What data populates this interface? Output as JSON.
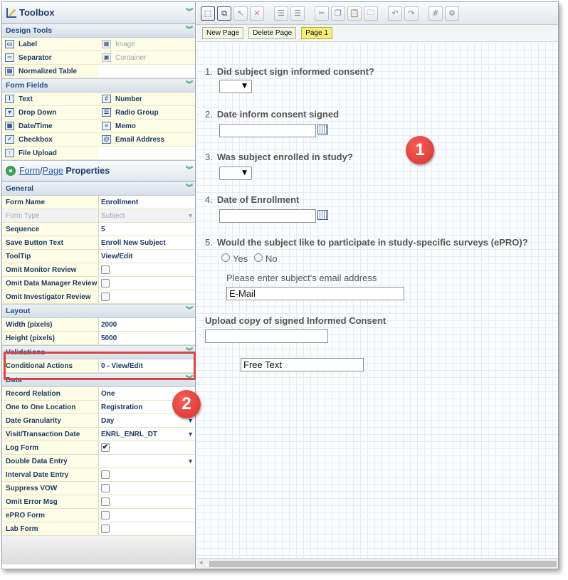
{
  "toolbox": {
    "title": "Toolbox",
    "design_tools": {
      "heading": "Design Tools",
      "items": [
        {
          "label": "Label",
          "icon": "label-icon",
          "enabled": true
        },
        {
          "label": "Image",
          "icon": "image-icon",
          "enabled": false
        },
        {
          "label": "Separator",
          "icon": "separator-icon",
          "enabled": true
        },
        {
          "label": "Container",
          "icon": "container-icon",
          "enabled": false
        },
        {
          "label": "Normalized Table",
          "icon": "table-icon",
          "enabled": true
        }
      ]
    },
    "form_fields": {
      "heading": "Form Fields",
      "items": [
        {
          "label": "Text",
          "icon": "text-field-icon"
        },
        {
          "label": "Number",
          "icon": "number-field-icon"
        },
        {
          "label": "Drop Down",
          "icon": "dropdown-icon"
        },
        {
          "label": "Radio Group",
          "icon": "radio-group-icon"
        },
        {
          "label": "Date/Time",
          "icon": "calendar-icon"
        },
        {
          "label": "Memo",
          "icon": "memo-icon"
        },
        {
          "label": "Checkbox",
          "icon": "checkbox-icon"
        },
        {
          "label": "Email Address",
          "icon": "email-icon"
        },
        {
          "label": "File Upload",
          "icon": "file-upload-icon"
        }
      ]
    }
  },
  "properties": {
    "title_prefix_1": "Form",
    "title_sep": "/",
    "title_prefix_2": "Page",
    "title_suffix": " Properties",
    "general": {
      "heading": "General",
      "form_name_label": "Form Name",
      "form_name": "Enrollment",
      "form_type_label": "Form Type",
      "form_type": "Subject",
      "sequence_label": "Sequence",
      "sequence": "5",
      "save_button_text_label": "Save Button Text",
      "save_button_text": "Enroll New Subject",
      "tooltip_label": "ToolTip",
      "tooltip": "View/Edit",
      "omit_monitor_label": "Omit Monitor Review",
      "omit_dm_label": "Omit Data Manager Review",
      "omit_investigator_label": "Omit Investigator Review"
    },
    "layout": {
      "heading": "Layout",
      "width_label": "Width (pixels)",
      "width": "2000",
      "height_label": "Height (pixels)",
      "height": "5000"
    },
    "validations": {
      "heading": "Validations",
      "conditional_actions_label": "Conditional Actions",
      "conditional_actions": "0 - View/Edit"
    },
    "data": {
      "heading": "Data",
      "record_relation_label": "Record Relation",
      "record_relation": "One",
      "one_to_one_label": "One to One Location",
      "one_to_one": "Registration",
      "date_granularity_label": "Date Granularity",
      "date_granularity": "Day",
      "visit_date_label": "Visit/Transaction Date",
      "visit_date": "ENRL_ENRL_DT",
      "log_form_label": "Log Form",
      "log_form_checked": true,
      "double_data_label": "Double Data Entry",
      "interval_date_label": "Interval Date Entry",
      "suppress_vow_label": "Suppress VOW",
      "omit_error_label": "Omit Error Msg",
      "epro_label": "ePRO Form",
      "lab_form_label": "Lab Form"
    }
  },
  "page_buttons": {
    "new_page": "New Page",
    "delete_page": "Delete Page",
    "page_1": "Page 1"
  },
  "form": {
    "q1_num": "1.",
    "q1": "Did subject sign informed consent?",
    "q2_num": "2.",
    "q2": "Date inform consent signed",
    "q3_num": "3.",
    "q3": "Was subject enrolled in study?",
    "q4_num": "4.",
    "q4": "Date of Enrollment",
    "q5_num": "5.",
    "q5": "Would the subject like to participate in study-specific surveys (ePRO)?",
    "yes": "Yes",
    "no": "No",
    "email_prompt": "Please enter subject's email address",
    "email_value": "E-Mail",
    "upload_label": "Upload copy of signed Informed Consent",
    "free_text_value": "Free Text"
  },
  "callouts": {
    "badge_1": "1",
    "badge_2": "2"
  },
  "colors": {
    "highlight_box": "#d9443f",
    "badge": "#e0403b",
    "current_page": "#f5ef7a"
  }
}
